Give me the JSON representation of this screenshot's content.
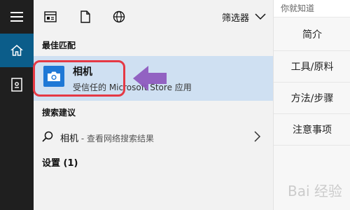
{
  "taskbar": {
    "icons": [
      "hamburger-icon",
      "home-icon",
      "notebook-icon"
    ]
  },
  "topbar": {
    "icons": [
      "app-view-icon",
      "document-icon",
      "web-icon"
    ],
    "filter_label": "筛选器"
  },
  "best_match": {
    "title": "最佳匹配",
    "app_name": "相机",
    "app_subtitle": "受信任的 Microsoft Store 应用",
    "outline_color": "#e53945",
    "arrow_color": "#8e5bbf"
  },
  "suggestions": {
    "title": "搜索建议",
    "item_query": "相机",
    "item_hint": " - 查看网络搜索结果"
  },
  "settings": {
    "label": "设置 (1)"
  },
  "background_page": {
    "top_text": "你就知道",
    "menu": [
      "简介",
      "工具/原料",
      "方法/步骤",
      "注意事项"
    ],
    "watermark": "Bai 经验"
  },
  "colors": {
    "rail": "#1f1f1f",
    "home_active": "#0b5d8a",
    "panel": "#f2f2f2",
    "highlight": "#cfe0f2",
    "app_icon": "#1e78d6"
  }
}
